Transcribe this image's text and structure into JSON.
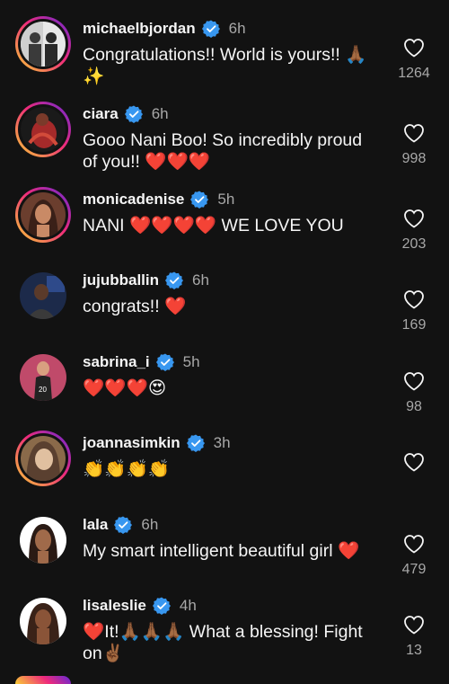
{
  "comments": [
    {
      "username": "michaelbjordan",
      "verified": true,
      "time": "6h",
      "line1": "Congratulations!! World is yours!! 🙏🏾",
      "line2": "✨",
      "likes": "1264",
      "avatar_colors": [
        "#e8e8e8",
        "#3a3a3a"
      ]
    },
    {
      "username": "ciara",
      "verified": true,
      "time": "6h",
      "line1": "Gooo Nani Boo! So incredibly proud",
      "line2": "of you!! ❤️❤️❤️",
      "likes": "998",
      "avatar_colors": [
        "#1a1a1a",
        "#c0392b"
      ]
    },
    {
      "username": "monicadenise",
      "verified": true,
      "time": "5h",
      "line1": "NANI ❤️❤️❤️❤️ WE LOVE YOU",
      "line2": "",
      "likes": "203",
      "avatar_colors": [
        "#6b3e2e",
        "#d9a07a"
      ]
    },
    {
      "username": "jujubballin",
      "verified": true,
      "time": "6h",
      "line1": "congrats!! ❤️",
      "line2": "",
      "likes": "169",
      "avatar_colors": [
        "#1c2a4a",
        "#5a5a5a"
      ]
    },
    {
      "username": "sabrina_i",
      "verified": true,
      "time": "5h",
      "line1": "❤️❤️❤️😍",
      "line2": "",
      "likes": "98",
      "avatar_colors": [
        "#c04a6a",
        "#222222"
      ]
    },
    {
      "username": "joannasimkin",
      "verified": true,
      "time": "3h",
      "line1": "👏👏👏👏",
      "line2": "",
      "likes": "",
      "avatar_colors": [
        "#8a6a4a",
        "#d8c0a0"
      ]
    },
    {
      "username": "lala",
      "verified": true,
      "time": "6h",
      "line1": "My smart intelligent beautiful girl ❤️",
      "line2": "",
      "likes": "479",
      "avatar_colors": [
        "#ffffff",
        "#8a5a3a"
      ]
    },
    {
      "username": "lisaleslie",
      "verified": true,
      "time": "4h",
      "line1": "❤️It!🙏🏾🙏🏾🙏🏾 What a blessing! Fight",
      "line2": "on✌🏾",
      "likes": "13",
      "avatar_colors": [
        "#ffffff",
        "#6a4030"
      ]
    }
  ],
  "colors": {
    "background": "#121212",
    "verified_blue": "#3897f0",
    "muted": "#a8a8a8"
  }
}
